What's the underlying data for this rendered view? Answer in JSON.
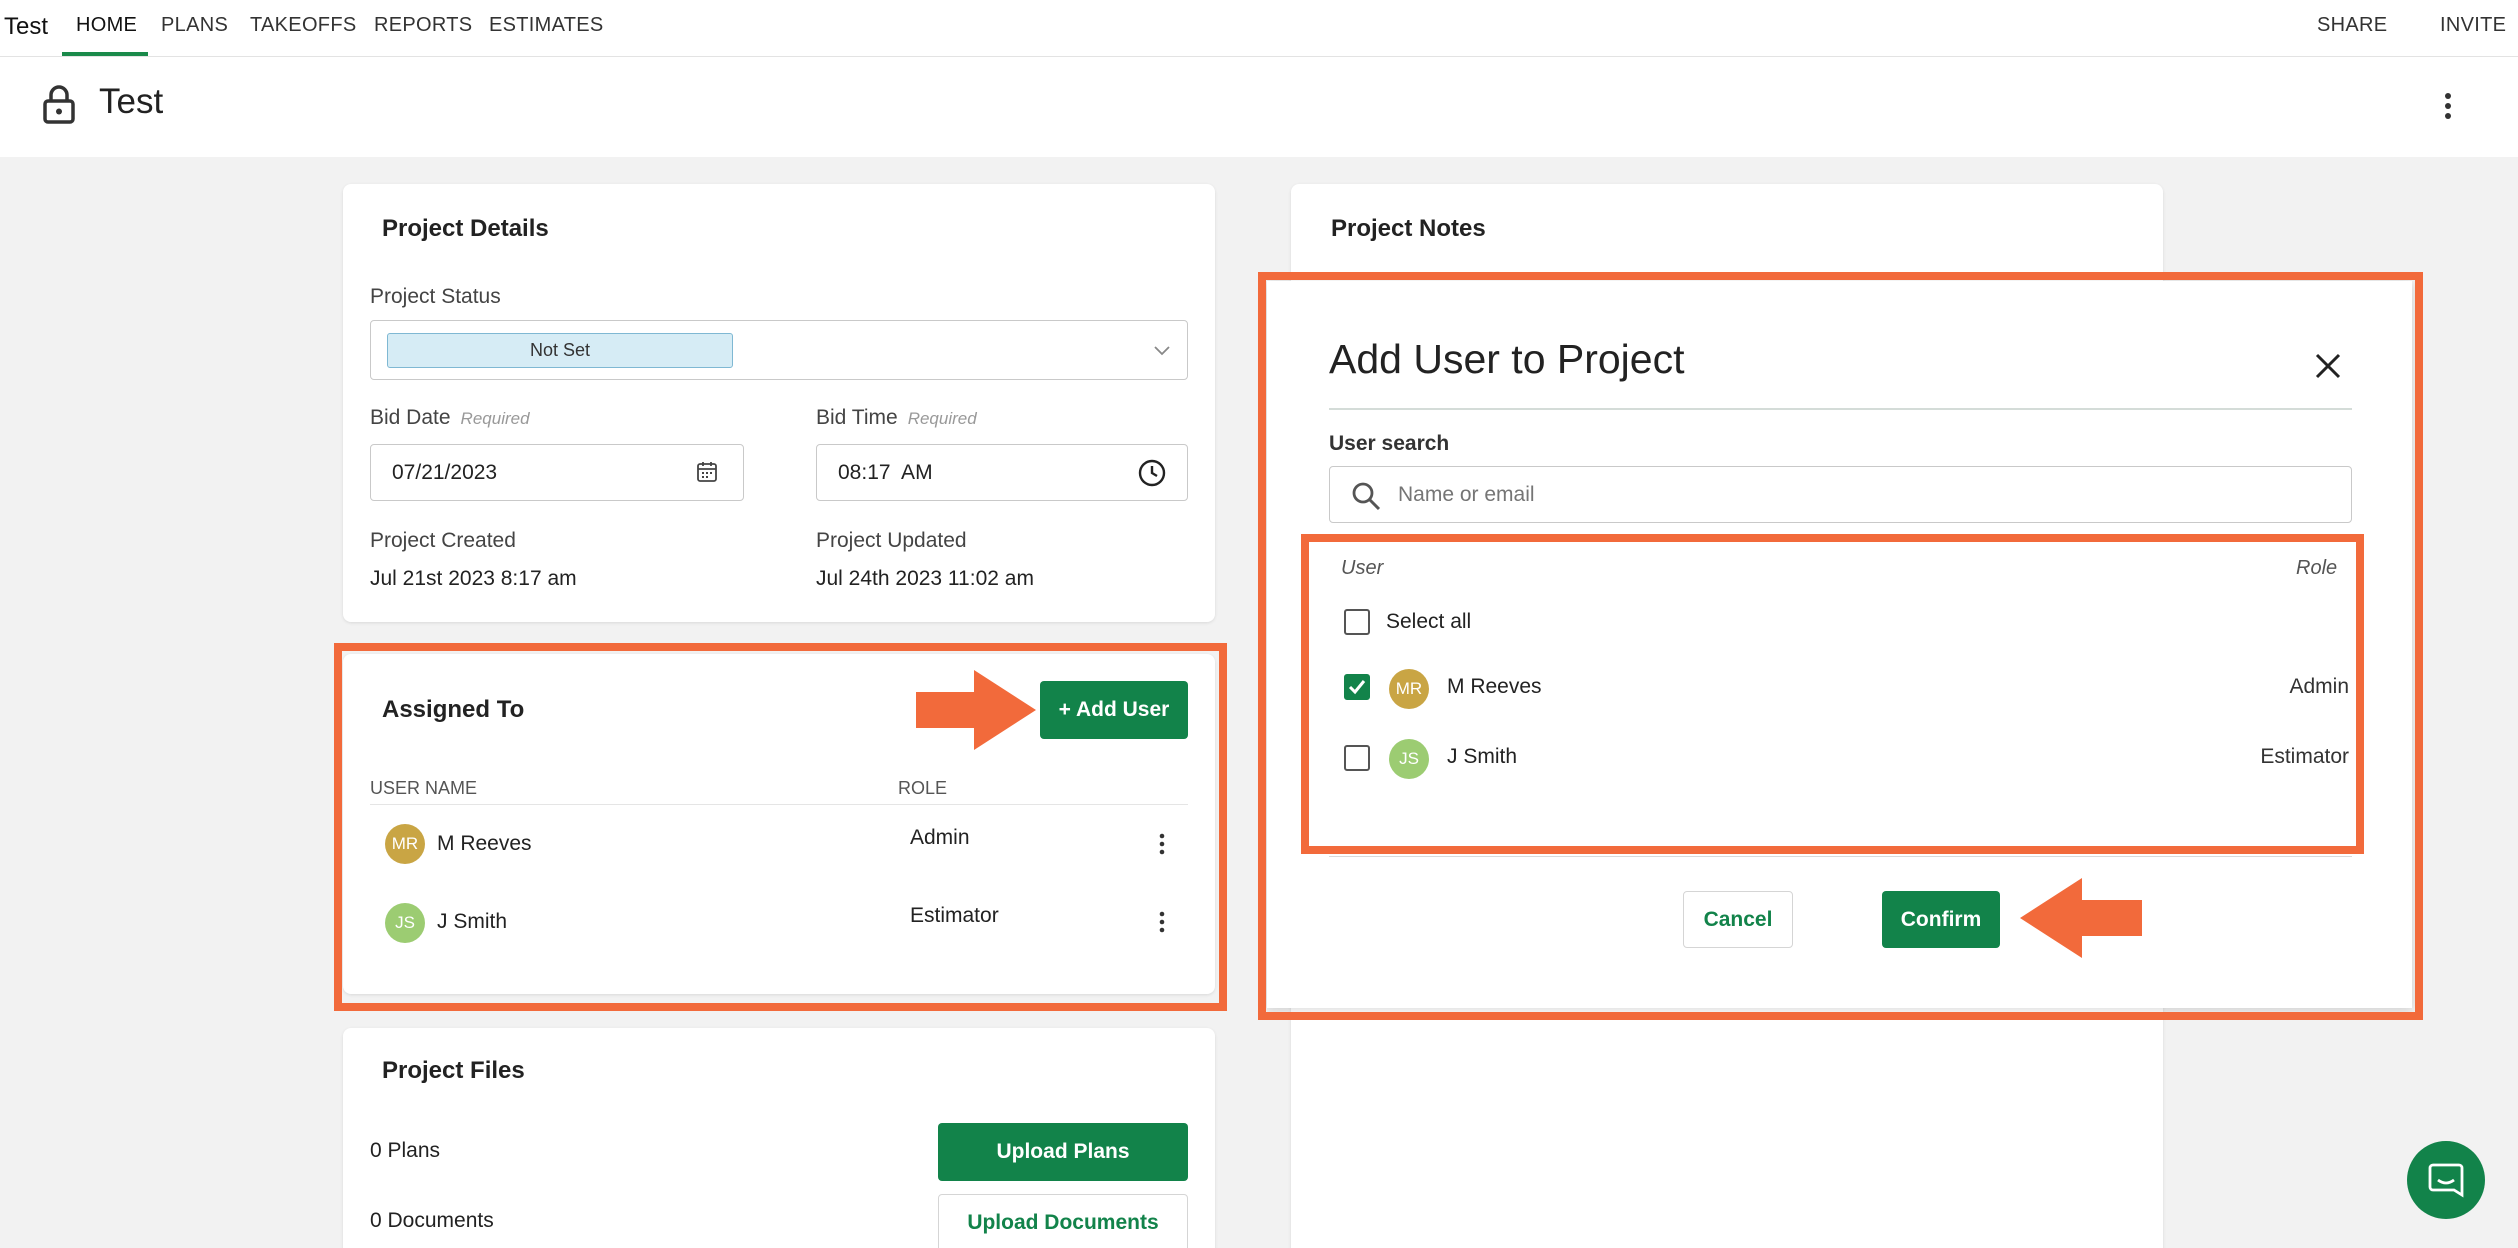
{
  "nav": {
    "brand": "Test",
    "links": [
      "HOME",
      "PLANS",
      "TAKEOFFS",
      "REPORTS",
      "ESTIMATES"
    ],
    "right": [
      "SHARE",
      "INVITE"
    ],
    "accent": "#1a8a4a"
  },
  "header": {
    "title": "Test"
  },
  "project_details": {
    "title": "Project Details",
    "status_label": "Project Status",
    "status_value": "Not Set",
    "bid_date_label": "Bid Date",
    "bid_date_required": "Required",
    "bid_date_value": "07/21/2023",
    "bid_time_label": "Bid Time",
    "bid_time_required": "Required",
    "bid_time_value": "08:17  AM",
    "created_label": "Project Created",
    "created_value": "Jul 21st 2023 8:17 am",
    "updated_label": "Project Updated",
    "updated_value": "Jul 24th 2023 11:02 am"
  },
  "assigned": {
    "title": "Assigned To",
    "add_user_label": "+ Add User",
    "col_user": "USER NAME",
    "col_role": "ROLE",
    "users": [
      {
        "initials": "MR",
        "name": "M Reeves",
        "role": "Admin"
      },
      {
        "initials": "JS",
        "name": "J Smith",
        "role": "Estimator"
      }
    ]
  },
  "files": {
    "title": "Project Files",
    "plans_count": "0 Plans",
    "docs_count": "0 Documents",
    "upload_plans": "Upload Plans",
    "upload_docs": "Upload Documents"
  },
  "notes": {
    "title": "Project Notes"
  },
  "modal": {
    "title": "Add User to Project",
    "search_label": "User search",
    "search_placeholder": "Name or email",
    "col_user": "User",
    "col_role": "Role",
    "select_all": "Select all",
    "users": [
      {
        "initials": "MR",
        "name": "M Reeves",
        "role": "Admin",
        "checked": true
      },
      {
        "initials": "JS",
        "name": "J Smith",
        "role": "Estimator",
        "checked": false
      }
    ],
    "cancel": "Cancel",
    "confirm": "Confirm"
  },
  "colors": {
    "highlight": "#f26a3b",
    "primary": "#12834a"
  }
}
